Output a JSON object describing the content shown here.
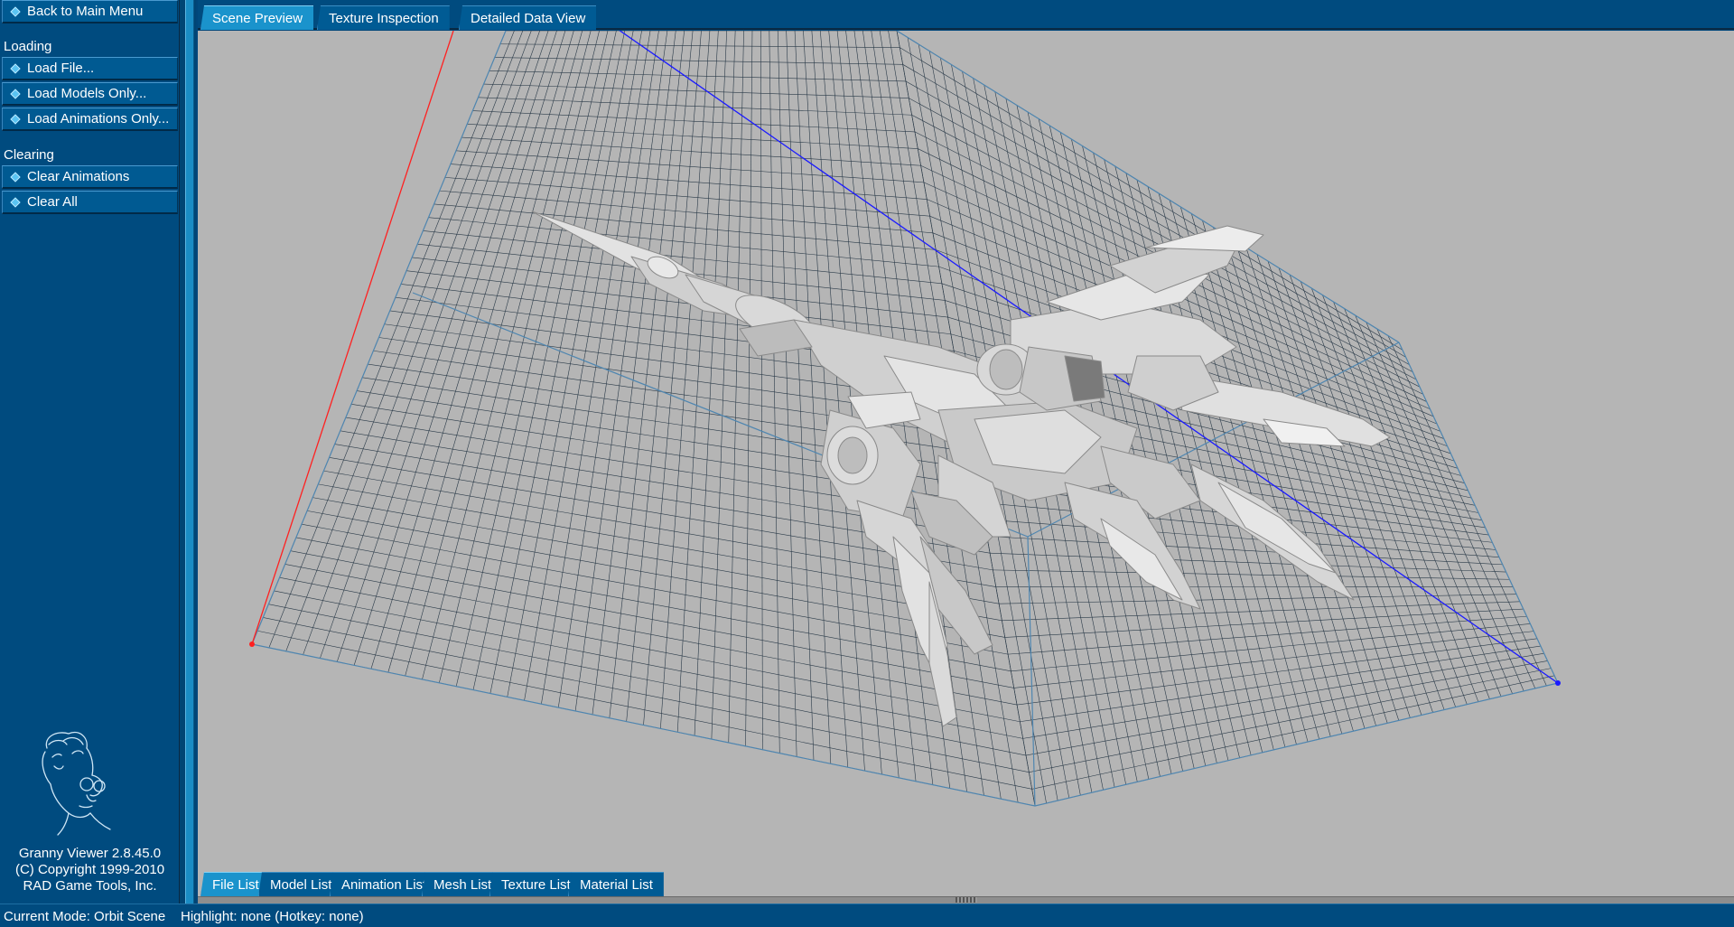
{
  "sidebar": {
    "back_label": "Back to Main Menu",
    "loading_label": "Loading",
    "load_file": "Load File...",
    "load_models": "Load Models Only...",
    "load_animations": "Load Animations Only...",
    "clearing_label": "Clearing",
    "clear_animations": "Clear Animations",
    "clear_all": "Clear All",
    "about": {
      "version": "Granny Viewer 2.8.45.0",
      "copyright": "(C) Copyright 1999-2010",
      "company": "RAD Game Tools, Inc."
    }
  },
  "top_tabs": [
    "Scene Preview",
    "Texture Inspection",
    "Detailed Data View"
  ],
  "active_top_tab": "Scene Preview",
  "bottom_tabs": [
    "File List",
    "Model List",
    "Animation List",
    "Mesh List",
    "Texture List",
    "Material List"
  ],
  "active_bottom_tab": "File List",
  "status": {
    "mode": "Current Mode: Orbit Scene",
    "highlight": "Highlight: none (Hotkey: none)"
  },
  "colors": {
    "ui_blue": "#004b7f",
    "tab_active": "#1a93cc",
    "viewport_bg": "#b5b5b5",
    "grid_line": "#2a3a48",
    "grid_edge": "#4f86b0",
    "axis_x": "#ff2020",
    "axis_z": "#1a1aff",
    "model": "#d8d8d8"
  },
  "icons": {
    "menu_bullet": "diamond-bullet-icon",
    "logo": "granny-mascot-logo"
  }
}
